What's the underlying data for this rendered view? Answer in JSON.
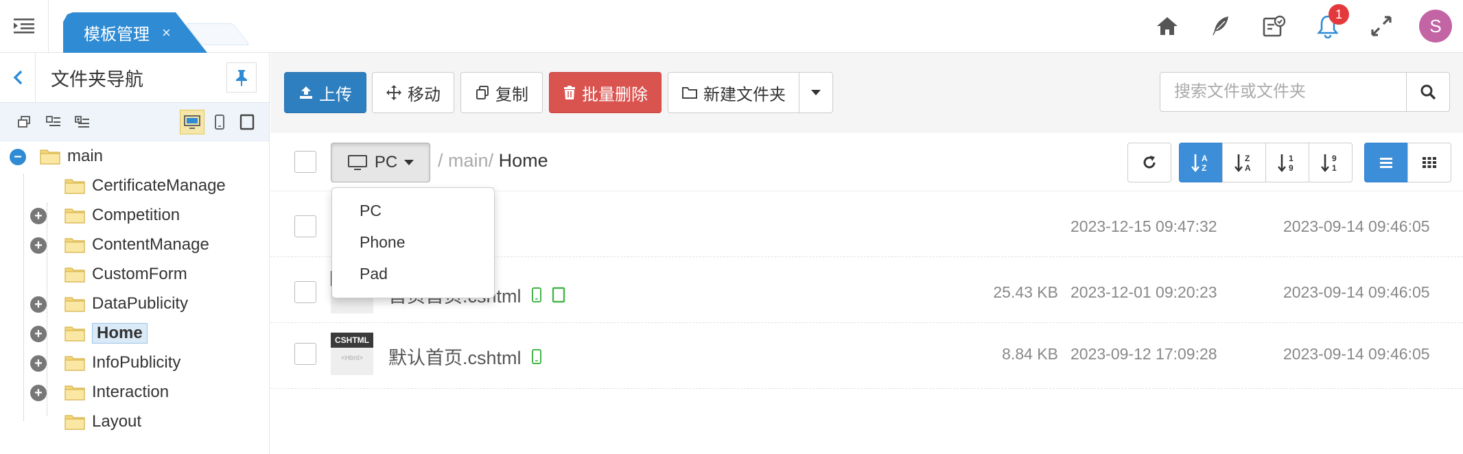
{
  "topbar": {
    "tab_label": "模板管理",
    "tab_close": "×",
    "notification_count": "1",
    "avatar_letter": "S",
    "icons": [
      "home-icon",
      "feather-icon",
      "task-icon",
      "bell-icon",
      "fullscreen-icon"
    ]
  },
  "sidebar": {
    "title": "文件夹导航",
    "tree": [
      {
        "label": "main",
        "expander": "minus"
      },
      {
        "label": "CertificateManage",
        "expander": ""
      },
      {
        "label": "Competition",
        "expander": "plus"
      },
      {
        "label": "ContentManage",
        "expander": "plus"
      },
      {
        "label": "CustomForm",
        "expander": ""
      },
      {
        "label": "DataPublicity",
        "expander": "plus"
      },
      {
        "label": "Home",
        "expander": "plus",
        "selected": true
      },
      {
        "label": "InfoPublicity",
        "expander": "plus"
      },
      {
        "label": "Interaction",
        "expander": "plus"
      },
      {
        "label": "Layout",
        "expander": ""
      }
    ]
  },
  "toolbar": {
    "upload": "上传",
    "move": "移动",
    "copy": "复制",
    "batch_delete": "批量删除",
    "new_folder": "新建文件夹",
    "search_placeholder": "搜索文件或文件夹"
  },
  "pathbar": {
    "device": "PC",
    "sep1": "/",
    "crumb_main": "main",
    "sep2": "/",
    "crumb_current": "Home"
  },
  "device_menu": [
    "PC",
    "Phone",
    "Pad"
  ],
  "files": [
    {
      "name": "",
      "size": "",
      "modified": "2023-12-15 09:47:32",
      "created": "2023-09-14 09:46:05",
      "badges": []
    },
    {
      "name": "首页首页.cshtml",
      "size": "25.43 KB",
      "modified": "2023-12-01 09:20:23",
      "created": "2023-09-14 09:46:05",
      "badges": [
        "phone",
        "pad"
      ]
    },
    {
      "name": "默认首页.cshtml",
      "size": "8.84 KB",
      "modified": "2023-09-12 17:09:28",
      "created": "2023-09-14 09:46:05",
      "badges": [
        "phone"
      ]
    }
  ],
  "thumb": {
    "label": "CSHTML",
    "sub": "<Html>"
  },
  "colors": {
    "primary": "#2e7fc0",
    "danger": "#d9534f",
    "accent": "#3d8ed8",
    "badge": "#e4393c",
    "device_ok": "#44b549"
  }
}
